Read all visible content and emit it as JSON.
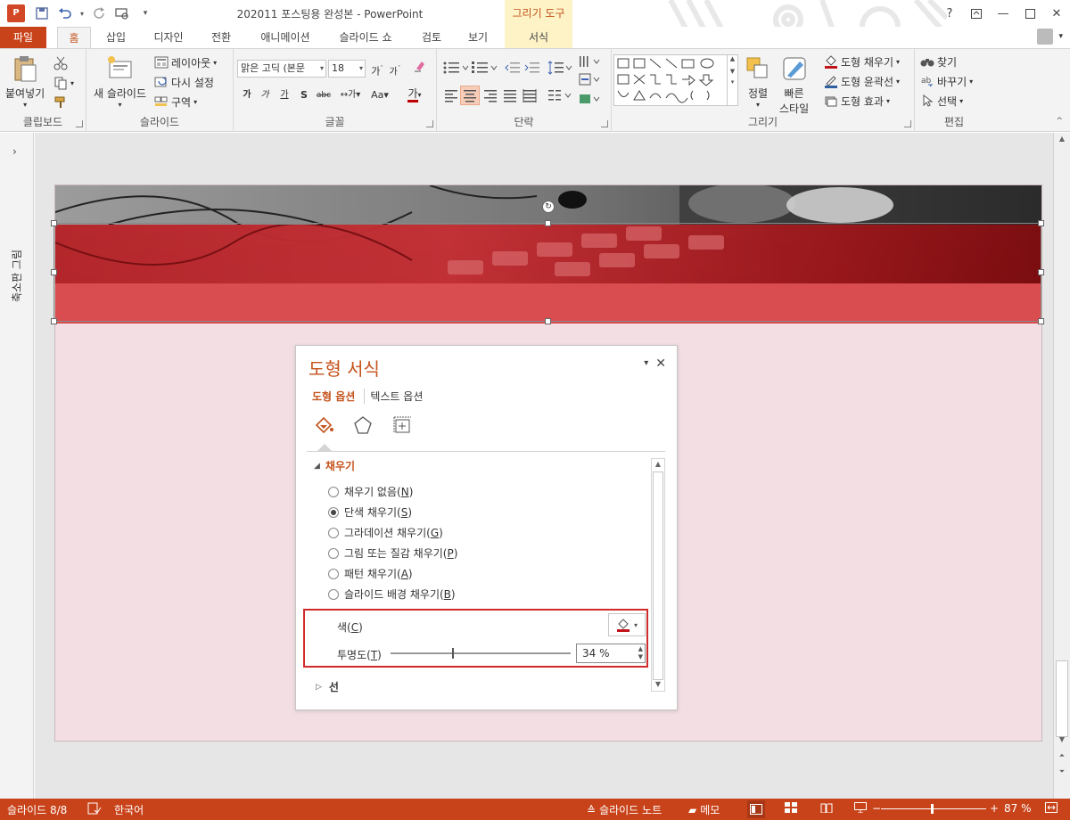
{
  "window": {
    "title": "202011 포스팅용 완성본 - PowerPoint",
    "context_group": "그리기 도구",
    "app_badge": "P"
  },
  "tabs": {
    "file": "파일",
    "home": "홈",
    "insert": "삽입",
    "design": "디자인",
    "transitions": "전환",
    "animations": "애니메이션",
    "slideshow": "슬라이드 쇼",
    "review": "검토",
    "view": "보기",
    "format": "서식"
  },
  "ribbon": {
    "clipboard": {
      "label": "클립보드",
      "paste": "붙여넣기"
    },
    "slides": {
      "label": "슬라이드",
      "new_slide": "새 슬라이드",
      "layout": "레이아웃",
      "reset": "다시 설정",
      "section": "구역"
    },
    "font": {
      "label": "글꼴",
      "font_name": "맑은 고딕 (본문",
      "font_size": "18"
    },
    "paragraph": {
      "label": "단락"
    },
    "drawing": {
      "label": "그리기",
      "arrange": "정렬",
      "quick_styles_1": "빠른",
      "quick_styles_2": "스타일",
      "shape_fill": "도형 채우기",
      "shape_outline": "도형 윤곽선",
      "shape_effects": "도형 효과"
    },
    "editing": {
      "label": "편집",
      "find": "찾기",
      "replace": "바꾸기",
      "select": "선택"
    }
  },
  "leftbar": {
    "label": "축소판 그림"
  },
  "pane": {
    "title": "도형 서식",
    "tab_shape": "도형 옵션",
    "tab_text": "텍스트 옵션",
    "fill_section": "채우기",
    "options": [
      {
        "label": "채우기 없음(",
        "key": "N",
        "checked": false
      },
      {
        "label": "단색 채우기(",
        "key": "S",
        "checked": true
      },
      {
        "label": "그라데이션 채우기(",
        "key": "G",
        "checked": false
      },
      {
        "label": "그림 또는 질감 채우기(",
        "key": "P",
        "checked": false
      },
      {
        "label": "패턴 채우기(",
        "key": "A",
        "checked": false
      },
      {
        "label": "슬라이드 배경 채우기(",
        "key": "B",
        "checked": false
      }
    ],
    "color_label": "색(",
    "color_key": "C",
    "transparency_label": "투명도(",
    "transparency_key": "T",
    "transparency_value": "34 %",
    "transparency_fraction": 0.34,
    "line_section": "선",
    "fill_color": "#c0141a"
  },
  "status": {
    "slide": "슬라이드 8/8",
    "language": "한국어",
    "notes": "슬라이드 노트",
    "comments": "메모",
    "zoom": "87 %"
  },
  "colors": {
    "accent": "#c9431a",
    "brand_orange": "#c5531d",
    "highlight": "#d12a2a"
  }
}
